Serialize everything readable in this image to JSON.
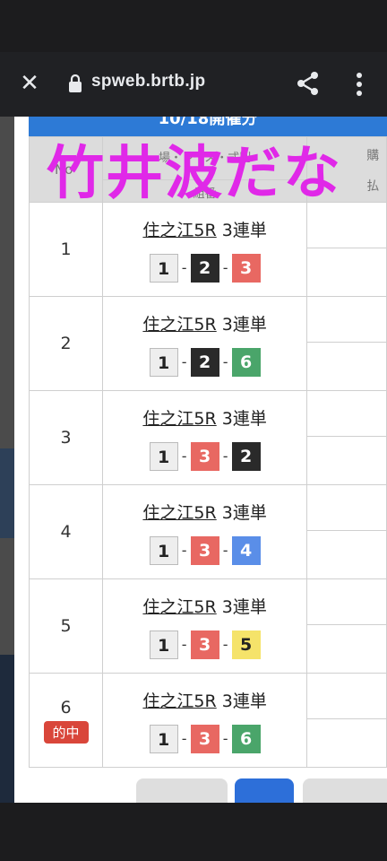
{
  "browser": {
    "url": "spweb.brtb.jp",
    "close_icon": "close-icon",
    "lock_icon": "lock-icon",
    "share_icon": "share-icon",
    "more_icon": "more-vert-icon"
  },
  "banner": {
    "text": "10/18開催分"
  },
  "table": {
    "headers": {
      "no": "No",
      "bet_line1": "場・レース・式別",
      "bet_line2": "組番",
      "pay_line1": "購",
      "pay_line2": "払"
    },
    "rows": [
      {
        "no": "1",
        "place": "住之江5R",
        "type": "3連単",
        "n1": "1",
        "n2": "2",
        "n3": "3",
        "hit": ""
      },
      {
        "no": "2",
        "place": "住之江5R",
        "type": "3連単",
        "n1": "1",
        "n2": "2",
        "n3": "6",
        "hit": ""
      },
      {
        "no": "3",
        "place": "住之江5R",
        "type": "3連単",
        "n1": "1",
        "n2": "3",
        "n3": "2",
        "hit": ""
      },
      {
        "no": "4",
        "place": "住之江5R",
        "type": "3連単",
        "n1": "1",
        "n2": "3",
        "n3": "4",
        "hit": ""
      },
      {
        "no": "5",
        "place": "住之江5R",
        "type": "3連単",
        "n1": "1",
        "n2": "3",
        "n3": "5",
        "hit": ""
      },
      {
        "no": "6",
        "place": "住之江5R",
        "type": "3連単",
        "n1": "1",
        "n2": "3",
        "n3": "6",
        "hit": "的中"
      }
    ],
    "separator": "-"
  },
  "overlay_text": "竹井波だな",
  "colors": {
    "overlay": "#e028e8",
    "banner": "#2d7ad6",
    "boat1": "#eeeeee",
    "boat2": "#2a2a2a",
    "boat3": "#e86862",
    "boat4": "#5a8ee8",
    "boat5": "#f5e36a",
    "boat6": "#4aa56a",
    "hit_badge": "#d9463a"
  }
}
